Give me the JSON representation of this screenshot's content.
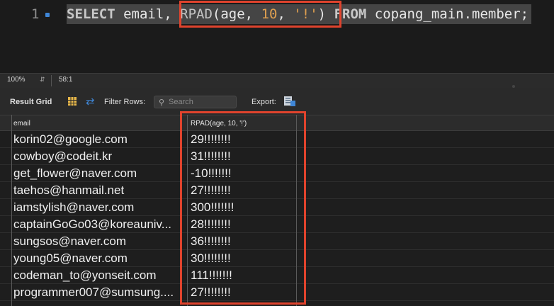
{
  "editor": {
    "line_number": "1",
    "query": {
      "select_kw": "SELECT",
      "column": " email, ",
      "func": "RPAD",
      "open": "(age, ",
      "num": "10",
      "comma": ", ",
      "str": "'!'",
      "close": ")",
      "from_kw": " FROM",
      "table": " copang_main.member;"
    }
  },
  "status": {
    "zoom": "100%",
    "cursor": "58:1"
  },
  "toolbar": {
    "result_grid": "Result Grid",
    "filter_rows": "Filter Rows:",
    "search_placeholder": "Search",
    "export": "Export:"
  },
  "grid": {
    "columns": [
      "email",
      "RPAD(age, 10, '!')"
    ],
    "rows": [
      {
        "email": "korin02@google.com",
        "rpad": "29!!!!!!!!"
      },
      {
        "email": "cowboy@codeit.kr",
        "rpad": "31!!!!!!!!"
      },
      {
        "email": "get_flower@naver.com",
        "rpad": "-10!!!!!!!"
      },
      {
        "email": "taehos@hanmail.net",
        "rpad": "27!!!!!!!!"
      },
      {
        "email": "iamstylish@naver.com",
        "rpad": "300!!!!!!!"
      },
      {
        "email": "captainGoGo03@koreauniv...",
        "rpad": "28!!!!!!!!"
      },
      {
        "email": "sungsos@naver.com",
        "rpad": "36!!!!!!!!"
      },
      {
        "email": "young05@naver.com",
        "rpad": "30!!!!!!!!"
      },
      {
        "email": "codeman_to@yonseit.com",
        "rpad": "111!!!!!!!"
      },
      {
        "email": "programmer007@sumsung....",
        "rpad": "27!!!!!!!!"
      }
    ]
  },
  "colors": {
    "highlight": "#e0432d",
    "accent": "#3f86d6"
  }
}
